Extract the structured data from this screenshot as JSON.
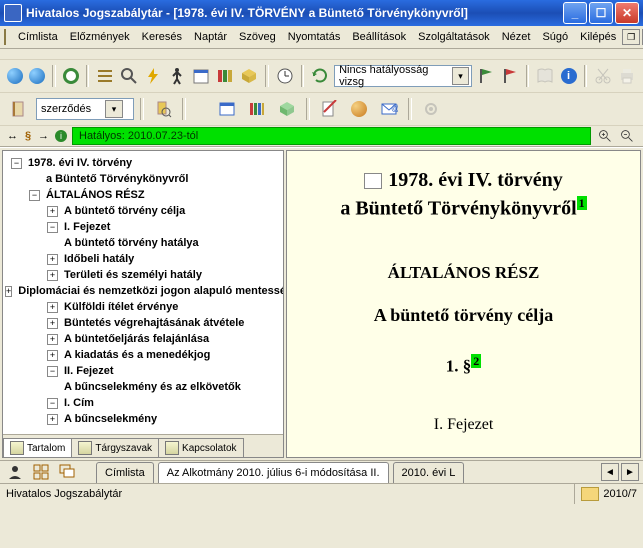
{
  "title": "Hivatalos Jogszabálytár - [1978. évi IV. TÖRVÉNY a Büntető Törvénykönyvről]",
  "menu": [
    "Címlista",
    "Előzmények",
    "Keresés",
    "Naptár",
    "Szöveg",
    "Nyomtatás",
    "Beállítások",
    "Szolgáltatások",
    "Nézet",
    "Súgó",
    "Kilépés"
  ],
  "toolbar2_combo": "Nincs hatályosság vizsg",
  "toolbar3_combo": "szerződés",
  "status_green": "Hatályos: 2010.07.23-tól",
  "tree": [
    {
      "indent": 0,
      "exp": "-",
      "bold": true,
      "label": "1978. évi IV. törvény"
    },
    {
      "indent": 1,
      "exp": "",
      "bold": true,
      "label": "a Büntető Törvénykönyvről"
    },
    {
      "indent": 1,
      "exp": "-",
      "bold": true,
      "label": "ÁLTALÁNOS RÉSZ"
    },
    {
      "indent": 2,
      "exp": "+",
      "bold": true,
      "label": "A büntető törvény célja"
    },
    {
      "indent": 2,
      "exp": "-",
      "bold": true,
      "label": "I. Fejezet"
    },
    {
      "indent": 2,
      "exp": "",
      "bold": true,
      "label": "A büntető törvény hatálya"
    },
    {
      "indent": 2,
      "exp": "+",
      "bold": true,
      "label": "Időbeli hatály"
    },
    {
      "indent": 2,
      "exp": "+",
      "bold": true,
      "label": "Területi és személyi hatály"
    },
    {
      "indent": 2,
      "exp": "+",
      "bold": true,
      "label": "Diplomáciai és nemzetközi jogon alapuló mentesség"
    },
    {
      "indent": 2,
      "exp": "+",
      "bold": true,
      "label": "Külföldi ítélet érvénye"
    },
    {
      "indent": 2,
      "exp": "+",
      "bold": true,
      "label": "Büntetés végrehajtásának átvétele"
    },
    {
      "indent": 2,
      "exp": "+",
      "bold": true,
      "label": "A büntetőeljárás felajánlása"
    },
    {
      "indent": 2,
      "exp": "+",
      "bold": true,
      "label": "A kiadatás és a menedékjog"
    },
    {
      "indent": 2,
      "exp": "-",
      "bold": true,
      "label": "II. Fejezet"
    },
    {
      "indent": 2,
      "exp": "",
      "bold": true,
      "label": "A bűncselekmény és az elkövetők"
    },
    {
      "indent": 2,
      "exp": "-",
      "bold": true,
      "label": "I. Cím"
    },
    {
      "indent": 2,
      "exp": "+",
      "bold": true,
      "label": "A bűncselekmény"
    }
  ],
  "tree_tabs": [
    "Tartalom",
    "Tárgyszavak",
    "Kapcsolatok"
  ],
  "content": {
    "line1": "1978. évi IV. törvény",
    "line2": "a Büntető Törvénykönyvről",
    "sup1": "1",
    "h2": "ÁLTALÁNOS RÉSZ",
    "h3": "A büntető törvény célja",
    "h4": "1. §",
    "sup2": "2",
    "h5": "I. Fejezet"
  },
  "doc_tabs": [
    "Címlista",
    "Az Alkotmány 2010. július 6-i módosítása II.",
    "2010. évi L"
  ],
  "bottom_status_left": "Hivatalos Jogszabálytár",
  "bottom_status_right": "2010/7"
}
